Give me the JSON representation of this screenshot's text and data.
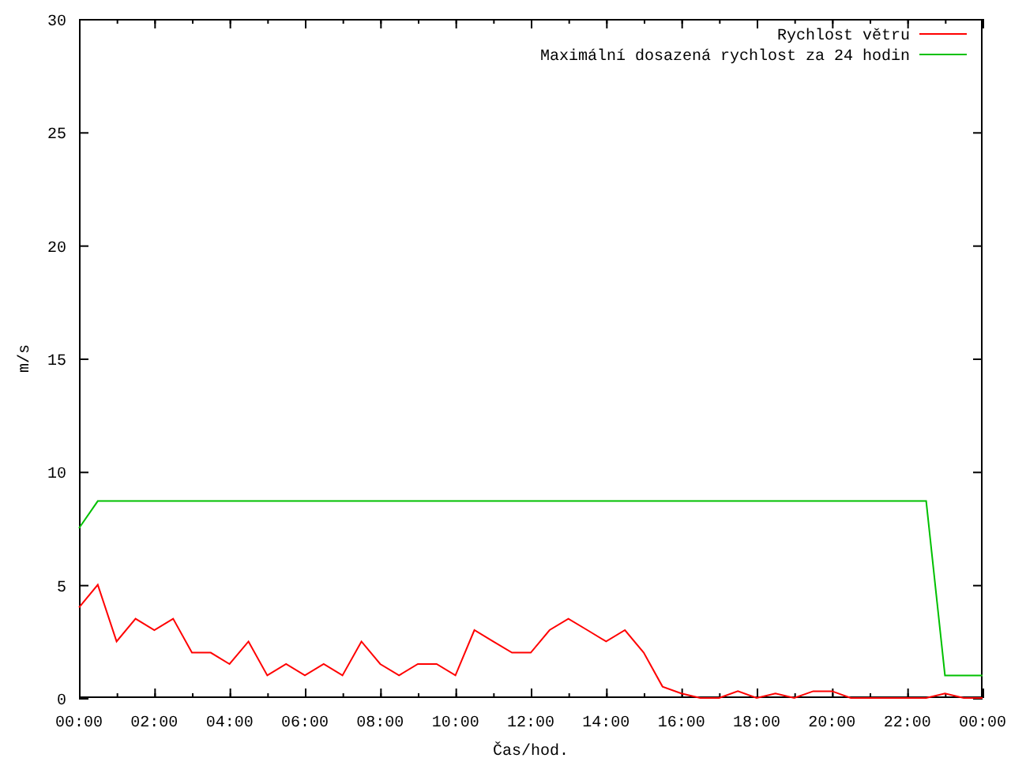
{
  "chart_data": {
    "type": "line",
    "legend": true,
    "xlabel": "Čas/hod.",
    "ylabel": "m/s",
    "xlim": [
      0,
      24
    ],
    "ylim": [
      0,
      30
    ],
    "xticks": [
      {
        "value": 0,
        "label": "00:00"
      },
      {
        "value": 2,
        "label": "02:00"
      },
      {
        "value": 4,
        "label": "04:00"
      },
      {
        "value": 6,
        "label": "06:00"
      },
      {
        "value": 8,
        "label": "08:00"
      },
      {
        "value": 10,
        "label": "10:00"
      },
      {
        "value": 12,
        "label": "12:00"
      },
      {
        "value": 14,
        "label": "14:00"
      },
      {
        "value": 16,
        "label": "16:00"
      },
      {
        "value": 18,
        "label": "18:00"
      },
      {
        "value": 20,
        "label": "20:00"
      },
      {
        "value": 22,
        "label": "22:00"
      },
      {
        "value": 24,
        "label": "00:00"
      }
    ],
    "yticks": [
      0,
      5,
      10,
      15,
      20,
      25,
      30
    ],
    "x": [
      0,
      0.5,
      1,
      1.5,
      2,
      2.5,
      3,
      3.5,
      4,
      4.5,
      5,
      5.5,
      6,
      6.5,
      7,
      7.5,
      8,
      8.5,
      9,
      9.5,
      10,
      10.5,
      11,
      11.5,
      12,
      12.5,
      13,
      13.5,
      14,
      14.5,
      15,
      15.5,
      16,
      16.5,
      17,
      17.5,
      18,
      18.5,
      19,
      19.5,
      20,
      20.5,
      21,
      21.5,
      22,
      22.5,
      23,
      23.5,
      24
    ],
    "series": [
      {
        "name": "Rychlost větru",
        "color": "#ff0000",
        "values": [
          4,
          5,
          2.5,
          3.5,
          3,
          3.5,
          2,
          2,
          1.5,
          2.5,
          1,
          1.5,
          1,
          1.5,
          1,
          2.5,
          1.5,
          1,
          1.5,
          1.5,
          1,
          3,
          2.5,
          2,
          2,
          3,
          3.5,
          3,
          2.5,
          3,
          2,
          0.5,
          0.2,
          0,
          0,
          0.3,
          0,
          0.2,
          0,
          0.3,
          0.3,
          0,
          0,
          0,
          0,
          0,
          0.2,
          0,
          0
        ]
      },
      {
        "name": "Maximální dosazená rychlost za 24 hodin",
        "color": "#00c000",
        "values": [
          7.5,
          8.7,
          8.7,
          8.7,
          8.7,
          8.7,
          8.7,
          8.7,
          8.7,
          8.7,
          8.7,
          8.7,
          8.7,
          8.7,
          8.7,
          8.7,
          8.7,
          8.7,
          8.7,
          8.7,
          8.7,
          8.7,
          8.7,
          8.7,
          8.7,
          8.7,
          8.7,
          8.7,
          8.7,
          8.7,
          8.7,
          8.7,
          8.7,
          8.7,
          8.7,
          8.7,
          8.7,
          8.7,
          8.7,
          8.7,
          8.7,
          8.7,
          8.7,
          8.7,
          8.7,
          8.7,
          1,
          1,
          1
        ]
      }
    ]
  }
}
